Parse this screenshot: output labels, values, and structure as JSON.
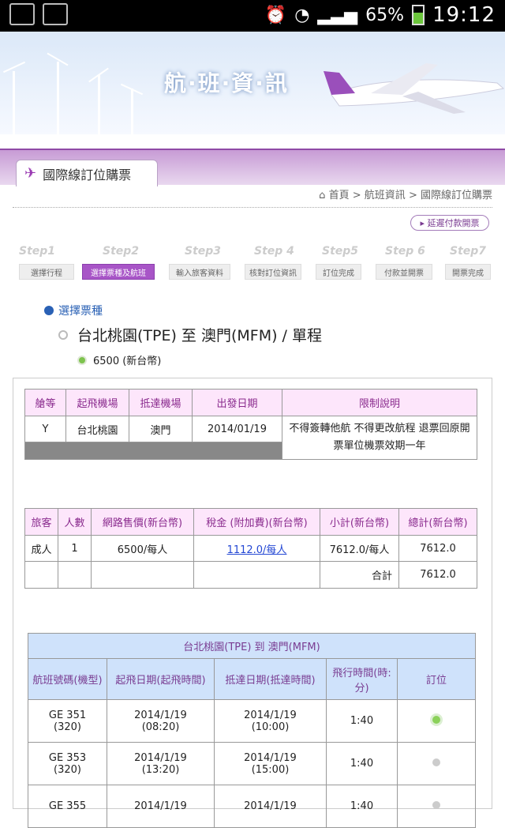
{
  "status": {
    "battery": "65%",
    "time": "19:12"
  },
  "banner": {
    "title": "航·班·資·訊"
  },
  "tab": {
    "label": "國際線訂位購票"
  },
  "breadcrumb": {
    "home": "首頁",
    "middle": "航班資訊",
    "current": "國際線訂位購票",
    "sep1": ">",
    "sep2": ">"
  },
  "buttons": {
    "pay_later": "延遲付款開票"
  },
  "steps": [
    {
      "num": "Step1",
      "label": "選擇行程"
    },
    {
      "num": "Step2",
      "label": "選擇票種及航班"
    },
    {
      "num": "Step3",
      "label": "輸入旅客資料"
    },
    {
      "num": "Step 4",
      "label": "核對訂位資訊"
    },
    {
      "num": "Step5",
      "label": "訂位完成"
    },
    {
      "num": "Step 6",
      "label": "付款並開票"
    },
    {
      "num": "Step7",
      "label": "開票完成"
    }
  ],
  "section": {
    "title": "選擇票種"
  },
  "route": {
    "text": "台北桃園(TPE)  至  澳門(MFM) / 單程"
  },
  "price_option": "6500 (新台幣)",
  "fare_table": {
    "headers": [
      "艙等",
      "起飛機場",
      "抵達機場",
      "出發日期",
      "限制說明"
    ],
    "row": [
      "Y",
      "台北桃園",
      "澳門",
      "2014/01/19",
      "不得簽轉他航 不得更改航程 退票回原開票單位機票效期一年"
    ]
  },
  "price_table": {
    "headers": [
      "旅客",
      "人數",
      "網路售價(新台幣)",
      "稅金 (附加費)(新台幣)",
      "小計(新台幣)",
      "總計(新台幣)"
    ],
    "row": [
      "成人",
      "1",
      "6500/每人",
      "1112.0/每人",
      "7612.0/每人",
      "7612.0"
    ],
    "total_label": "合計",
    "total_value": "7612.0"
  },
  "flight_table": {
    "title": "台北桃園(TPE) 到 澳門(MFM)",
    "headers": [
      "航班號碼(機型)",
      "起飛日期(起飛時間)",
      "抵達日期(抵達時間)",
      "飛行時間(時:分)",
      "訂位"
    ],
    "rows": [
      [
        "GE 351",
        "(320)",
        "2014/1/19",
        "(08:20)",
        "2014/1/19",
        "(10:00)",
        "1:40"
      ],
      [
        "GE 353",
        "(320)",
        "2014/1/19",
        "(13:20)",
        "2014/1/19",
        "(15:00)",
        "1:40"
      ],
      [
        "GE 355",
        "",
        "2014/1/19",
        "",
        "2014/1/19",
        "",
        "1:40"
      ]
    ]
  }
}
